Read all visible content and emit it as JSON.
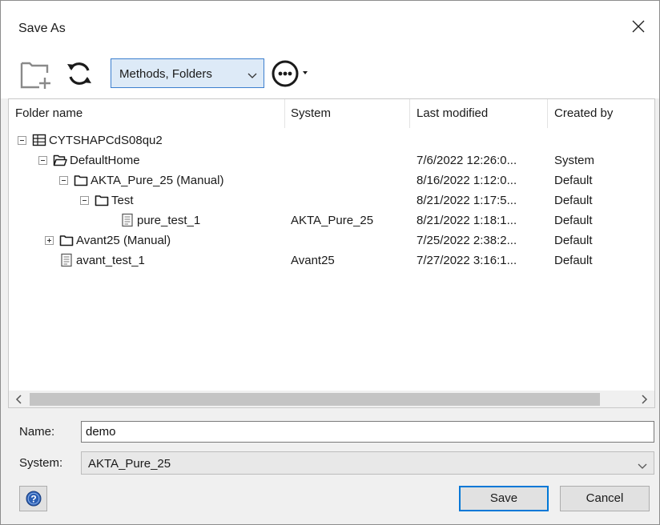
{
  "window": {
    "title": "Save As"
  },
  "icons": {
    "close": "close-icon",
    "new_folder": "new-folder-icon",
    "refresh": "refresh-icon",
    "more": "more-options-icon",
    "help": "help-icon"
  },
  "toolbar": {
    "view_filter_value": "Methods, Folders"
  },
  "columns": [
    "Folder name",
    "System",
    "Last modified",
    "Created by"
  ],
  "tree": [
    {
      "name": "CYTSHAPCdS08qu2",
      "system": "",
      "last_modified": "",
      "created_by": "",
      "type": "database",
      "expander": "minus"
    },
    {
      "name": "DefaultHome",
      "system": "",
      "last_modified": "7/6/2022 12:26:0...",
      "created_by": "System",
      "type": "folder-open",
      "expander": "minus"
    },
    {
      "name": "AKTA_Pure_25 (Manual)",
      "system": "",
      "last_modified": "8/16/2022 1:12:0...",
      "created_by": "Default",
      "type": "folder",
      "expander": "minus"
    },
    {
      "name": "Test",
      "system": "",
      "last_modified": "8/21/2022 1:17:5...",
      "created_by": "Default",
      "type": "folder",
      "expander": "minus"
    },
    {
      "name": "pure_test_1",
      "system": "AKTA_Pure_25",
      "last_modified": "8/21/2022 1:18:1...",
      "created_by": "Default",
      "type": "method",
      "expander": ""
    },
    {
      "name": "Avant25 (Manual)",
      "system": "",
      "last_modified": "7/25/2022 2:38:2...",
      "created_by": "Default",
      "type": "folder",
      "expander": "plus"
    },
    {
      "name": "avant_test_1",
      "system": "Avant25",
      "last_modified": "7/27/2022 3:16:1...",
      "created_by": "Default",
      "type": "method",
      "expander": ""
    }
  ],
  "form": {
    "name_label": "Name:",
    "name_value": "demo",
    "system_label": "System:",
    "system_value": "AKTA_Pure_25"
  },
  "buttons": {
    "save": "Save",
    "cancel": "Cancel"
  },
  "colors": {
    "accent": "#0078d7",
    "selection_bg": "#ddeaf7",
    "help_blue": "#2b5fb4"
  }
}
